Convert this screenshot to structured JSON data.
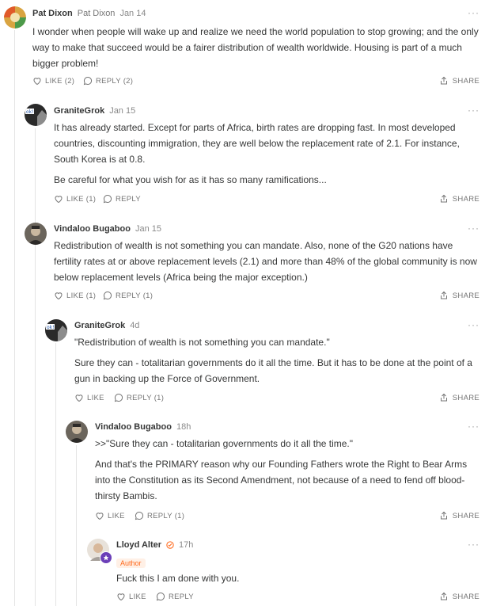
{
  "more_glyph": "···",
  "icons": {
    "like": "heart-icon",
    "reply": "speech-bubble-icon",
    "share": "share-icon",
    "verified": "verified-badge-icon",
    "star": "star-icon"
  },
  "colors": {
    "accent": "#ff6719",
    "text": "#363737",
    "muted": "#757575",
    "line": "#e4e4e4"
  },
  "comments": [
    {
      "author": "Pat Dixon",
      "handle": "Pat Dixon",
      "date": "Jan 14",
      "paragraphs": [
        "I wonder when people will wake up and realize we need the world population to stop growing; and the only way to make that succeed would be a fairer distribution of wealth worldwide. Housing is part of a much bigger problem!"
      ],
      "like_label": "LIKE (2)",
      "reply_label": "REPLY (2)",
      "share_label": "SHARE"
    },
    {
      "author": "GraniteGrok",
      "date": "Jan 15",
      "paragraphs": [
        "It has already started. Except for parts of Africa, birth rates are dropping fast. In most developed countries, discounting immigration, they are well below the replacement rate of 2.1. For instance, South Korea is at 0.8.",
        "Be careful for what you wish for as it has so many ramifications..."
      ],
      "like_label": "LIKE (1)",
      "reply_label": "REPLY",
      "share_label": "SHARE"
    },
    {
      "author": "Vindaloo Bugaboo",
      "date": "Jan 15",
      "paragraphs": [
        "Redistribution of wealth is not something you can mandate. Also, none of the G20 nations have fertility rates at or above replacement levels (2.1) and more than 48% of the global community is now below replacement levels (Africa being the major exception.)"
      ],
      "like_label": "LIKE (1)",
      "reply_label": "REPLY (1)",
      "share_label": "SHARE"
    },
    {
      "author": "GraniteGrok",
      "date": "4d",
      "paragraphs": [
        "\"Redistribution of wealth is not something you can mandate.\"",
        "Sure they can - totalitarian governments do it all the time. But it has to be done at the point of a gun in backing up the Force of Government."
      ],
      "like_label": "LIKE",
      "reply_label": "REPLY (1)",
      "share_label": "SHARE"
    },
    {
      "author": "Vindaloo Bugaboo",
      "date": "18h",
      "paragraphs": [
        ">>\"Sure they can - totalitarian governments do it all the time.\"",
        "And that's the PRIMARY reason why our Founding Fathers wrote the Right to Bear Arms into the Constitution as its Second Amendment, not because of a need to fend off blood-thirsty Bambis."
      ],
      "like_label": "LIKE",
      "reply_label": "REPLY (1)",
      "share_label": "SHARE"
    },
    {
      "author": "Lloyd Alter",
      "date": "17h",
      "badge": "Author",
      "paragraphs": [
        "Fuck this I am done with you."
      ],
      "like_label": "LIKE",
      "reply_label": "REPLY",
      "share_label": "SHARE"
    }
  ]
}
